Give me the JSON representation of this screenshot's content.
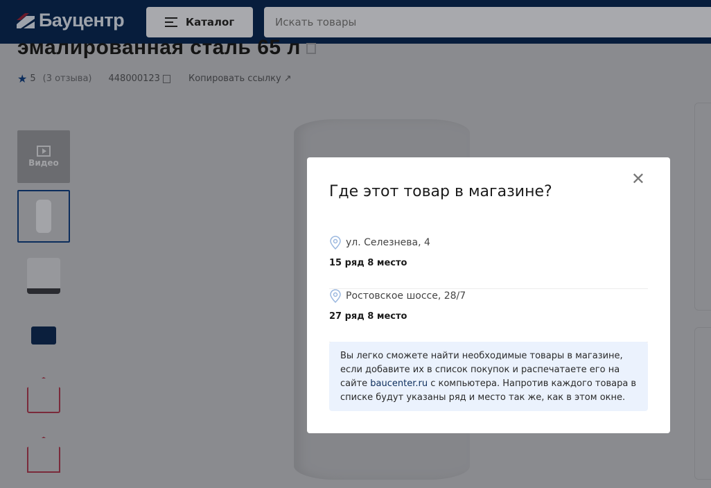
{
  "header": {
    "logo_text": "Бауцентр",
    "catalog_label": "Каталог",
    "search_placeholder": "Искать товары"
  },
  "product": {
    "title": "эмалированная сталь 65 л",
    "rating": "5",
    "reviews": "(3 отзыва)",
    "sku": "448000123",
    "copy_link": "Копировать ссылку"
  },
  "thumbnails": {
    "video_label": "Видео"
  },
  "modal": {
    "title": "Где этот товар в магазине?",
    "stores": [
      {
        "address": "ул. Селезнева, 4",
        "place": "15 ряд 8 место"
      },
      {
        "address": "Ростовское шоссе, 28/7",
        "place": "27 ряд 8 место"
      }
    ],
    "info_before": "Вы легко сможете найти необходимые товары в магазине, если добавите их в список покупок и распечатаете его на сайте ",
    "info_link": "baucenter.ru",
    "info_after": " с компьютера. Напротив каждого товара в списке будут указаны ряд и место так же, как в этом окне."
  },
  "colors": {
    "brand": "#0c2d5c",
    "overlay": "#8a8b8f",
    "info_bg": "#ebf2fd"
  }
}
